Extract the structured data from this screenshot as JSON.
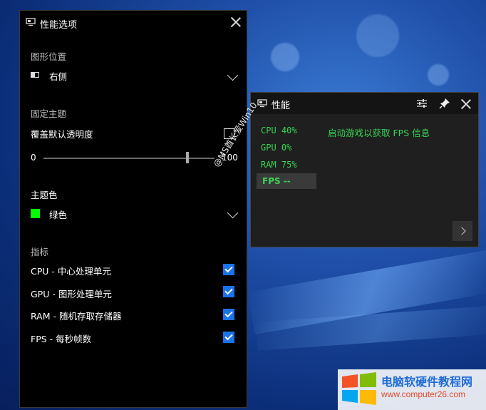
{
  "settings_panel": {
    "title": "性能选项",
    "graph_position_label": "图形位置",
    "graph_position_value": "右侧",
    "lock_theme_label": "固定主题",
    "override_opacity_label": "覆盖默认透明度",
    "slider_min": "0",
    "slider_max": "100",
    "slider_value_fraction": 0.85,
    "theme_color_label": "主题色",
    "theme_color_value": "绿色",
    "theme_color_hex": "#00ff00",
    "metrics_label": "指标",
    "metrics": [
      {
        "label": "CPU - 中心处理单元",
        "checked": true
      },
      {
        "label": "GPU - 图形处理单元",
        "checked": true
      },
      {
        "label": "RAM - 随机存取存储器",
        "checked": true
      },
      {
        "label": "FPS - 每秒帧数",
        "checked": true
      }
    ]
  },
  "perf_overlay": {
    "title": "性能",
    "cpu": "CPU  40%",
    "gpu": "GPU   0%",
    "ram": "RAM  75%",
    "fps": "FPS --",
    "message": "启动游戏以获取 FPS 信息"
  },
  "watermark": "@MS酋长爱Win10",
  "brand": {
    "name": "电脑软硬件教程网",
    "url": "www.computer26.com"
  },
  "colors": {
    "accent_blue": "#1a73e8",
    "metric_green": "#39d353"
  }
}
